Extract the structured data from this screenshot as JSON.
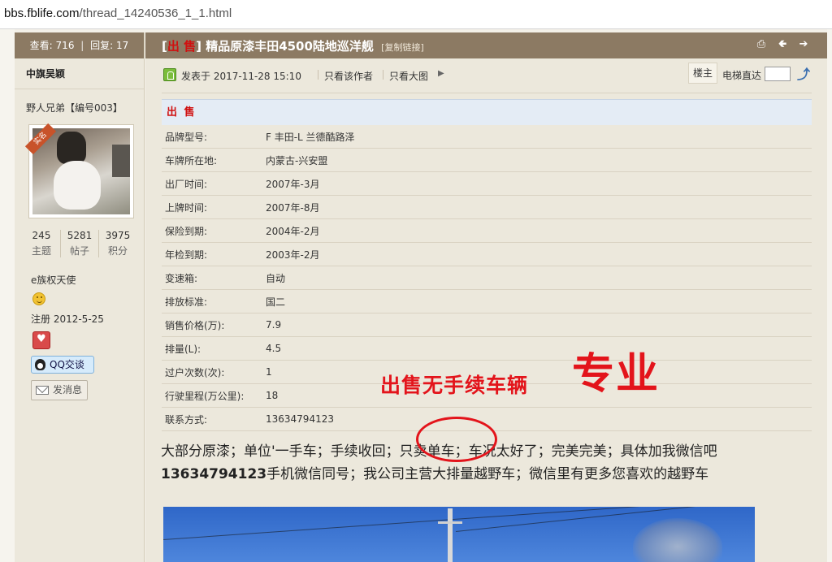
{
  "browser": {
    "url_host": "bbs.fblife.com",
    "url_path": "/thread_14240536_1_1.html"
  },
  "thread_stats": {
    "views_label": "查看:",
    "views": "716",
    "replies_label": "回复:",
    "replies": "17"
  },
  "user": {
    "name": "中旗吴颖",
    "title": "野人兄弟【编号003】",
    "avatar_badge": "实名",
    "counts": [
      {
        "num": "245",
        "label": "主题"
      },
      {
        "num": "5281",
        "label": "帖子"
      },
      {
        "num": "3975",
        "label": "积分"
      }
    ],
    "group": "e族权天使",
    "registered": "注册 2012-5-25",
    "qq_label": "QQ交谈",
    "message_label": "发消息"
  },
  "post": {
    "title_tag": "出 售",
    "title": "精品原漆丰田4500陆地巡洋舰",
    "copy_link": "[复制链接]",
    "posted": "发表于 2017-11-28 15:10",
    "only_author": "只看该作者",
    "large_image": "只看大图",
    "floor": "楼主",
    "elevator": "电梯直达"
  },
  "spec": {
    "heading": "出 售",
    "rows": [
      {
        "k": "品牌型号:",
        "v": "F 丰田-L 兰德酷路泽"
      },
      {
        "k": "车牌所在地:",
        "v": "内蒙古-兴安盟"
      },
      {
        "k": "出厂时间:",
        "v": "2007年-3月"
      },
      {
        "k": "上牌时间:",
        "v": "2007年-8月"
      },
      {
        "k": "保险到期:",
        "v": "2004年-2月"
      },
      {
        "k": "年检到期:",
        "v": "2003年-2月"
      },
      {
        "k": "变速箱:",
        "v": "自动"
      },
      {
        "k": "排放标准:",
        "v": "国二"
      },
      {
        "k": "销售价格(万):",
        "v": "7.9"
      },
      {
        "k": "排量(L):",
        "v": "4.5"
      },
      {
        "k": "过户次数(次):",
        "v": "1"
      },
      {
        "k": "行驶里程(万公里):",
        "v": "18"
      },
      {
        "k": "联系方式:",
        "v": "13634794123"
      }
    ]
  },
  "overlay": {
    "small": "出售无手续车辆",
    "big": "专业"
  },
  "body": {
    "line1": "大部分原漆；单位'一手车；手续收回；只卖单车；车况太好了；完美完美；具体加我微信吧",
    "phone": "13634794123",
    "line2": "手机微信同号；我公司主营大排量越野车；微信里有更多您喜欢的越野车"
  },
  "icons": {
    "print": "print-icon",
    "prev": "arrow-left-icon",
    "next": "arrow-right-icon"
  },
  "colors": {
    "header_brown": "#8c7a63",
    "accent_red": "#d01010",
    "annotation_red": "#e3141b"
  }
}
